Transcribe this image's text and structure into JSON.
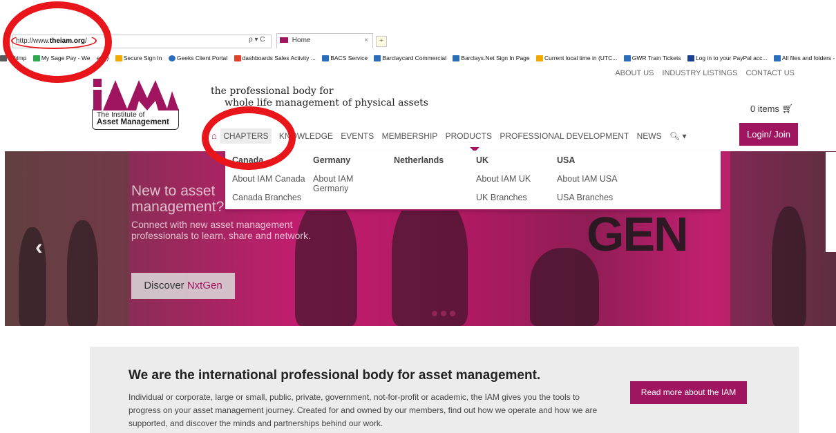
{
  "browser": {
    "url_prefix": "http://www.",
    "url_domain": "theiam.org",
    "url_suffix": "/",
    "address_tools": "ρ ▾ C",
    "tab_title": "Home",
    "tab_close": "×",
    "favorites": [
      {
        "label": "ilchimp",
        "color": "#5a5a5a"
      },
      {
        "label": "My Sage Pay - We",
        "color": "#2fa84f"
      },
      {
        "label": "e (3)",
        "color": "#ffffff"
      },
      {
        "label": "Secure Sign In",
        "color": "#f2a900"
      },
      {
        "label": "Geeks Client Portal",
        "color": "#2a6ebb"
      },
      {
        "label": "dashboards Sales Activity ...",
        "color": "#e0412b"
      },
      {
        "label": "BACS Service",
        "color": "#2a6ebb"
      },
      {
        "label": "Barclaycard Commercial",
        "color": "#2a6ebb"
      },
      {
        "label": "Barclays.Net Sign In Page",
        "color": "#2a6ebb"
      },
      {
        "label": "Current local time in (UTC...",
        "color": "#f2a900"
      },
      {
        "label": "GWR Train Tickets",
        "color": "#2a6ebb"
      },
      {
        "label": "Log in to your PayPal acc...",
        "color": "#1c3f94"
      },
      {
        "label": "All files and folders - I",
        "color": "#2a6ebb"
      }
    ]
  },
  "site": {
    "top_links": [
      "ABOUT US",
      "INDUSTRY LISTINGS",
      "CONTACT US"
    ],
    "logo_line1": "The Institute of",
    "logo_line2": "Asset Management",
    "tagline_line1": "the professional body for",
    "tagline_line2": "whole life management of physical assets",
    "cart_label": "0 items",
    "login_label": "Login/ Join",
    "brand_color": "#a0155f"
  },
  "nav": {
    "home_icon": "home-icon",
    "items": [
      "CHAPTERS",
      "KNOWLEDGE",
      "EVENTS",
      "MEMBERSHIP",
      "PRODUCTS",
      "PROFESSIONAL DEVELOPMENT",
      "NEWS"
    ],
    "search_icon": "search-icon"
  },
  "dropdown": {
    "columns": [
      {
        "head": "Canada",
        "links": [
          "About IAM Canada",
          "Canada Branches"
        ]
      },
      {
        "head": "Germany",
        "links": [
          "About IAM Germany"
        ]
      },
      {
        "head": "Netherlands",
        "links": []
      },
      {
        "head": "UK",
        "links": [
          "About IAM UK",
          "UK Branches"
        ]
      },
      {
        "head": "USA",
        "links": [
          "About IAM USA",
          "USA Branches"
        ]
      }
    ]
  },
  "hero": {
    "title": "New to asset management?",
    "subtitle": "Connect with new asset management professionals to learn, share and network.",
    "button_prefix": "Discover ",
    "button_accent": "NxtGen",
    "big_text": "GEN"
  },
  "about": {
    "heading": "We are the international professional body for asset management.",
    "body": "Individual or corporate, large or small, public, private, government, not-for-profit or academic, the IAM gives you the tools to progress on your asset management journey. Created for and owned by our members, find out how we operate and how we are supported, and discover the minds and partnerships behind our work.",
    "button": "Read more about the IAM"
  }
}
